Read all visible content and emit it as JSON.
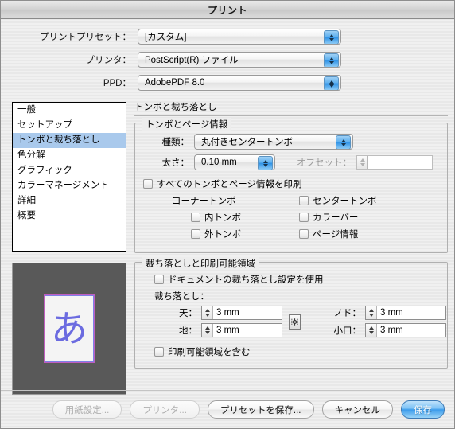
{
  "window": {
    "title": "プリント"
  },
  "top": {
    "rows": [
      {
        "label": "プリントプリセット：",
        "value": "[カスタム]"
      },
      {
        "label": "プリンタ：",
        "value": "PostScript(R) ファイル"
      },
      {
        "label": "PPD：",
        "value": "AdobePDF 8.0"
      }
    ]
  },
  "sidebar": {
    "items": [
      {
        "label": "一般"
      },
      {
        "label": "セットアップ"
      },
      {
        "label": "トンボと裁ち落とし"
      },
      {
        "label": "色分解"
      },
      {
        "label": "グラフィック"
      },
      {
        "label": "カラーマネージメント"
      },
      {
        "label": "詳細"
      },
      {
        "label": "概要"
      }
    ],
    "selected_index": 2
  },
  "preview": {
    "glyph": "あ"
  },
  "pane": {
    "heading": "トンボと裁ち落とし",
    "marks_group": {
      "title": "トンボとページ情報",
      "type_label": "種類：",
      "type_value": "丸付きセンタートンボ",
      "weight_label": "太さ：",
      "weight_value": "0.10 mm",
      "offset_label": "オフセット：",
      "offset_value": "",
      "print_all_label": "すべてのトンボとページ情報を印刷",
      "corner_label": "コーナートンボ",
      "inner_label": "内トンボ",
      "outer_label": "外トンボ",
      "center_label": "センタートンボ",
      "colorbar_label": "カラーバー",
      "pageinfo_label": "ページ情報"
    },
    "bleed_group": {
      "title": "裁ち落としと印刷可能領域",
      "use_doc_bleed_label": "ドキュメントの裁ち落とし設定を使用",
      "bleed_label": "裁ち落とし：",
      "top_label": "天：",
      "top_value": "3 mm",
      "bottom_label": "地：",
      "bottom_value": "3 mm",
      "inside_label": "ノド：",
      "inside_value": "3 mm",
      "outside_label": "小口：",
      "outside_value": "3 mm",
      "include_printable_label": "印刷可能領域を含む"
    }
  },
  "footer": {
    "buttons": [
      {
        "label": "用紙設定...",
        "state": "disabled"
      },
      {
        "label": "プリンタ...",
        "state": "disabled"
      },
      {
        "label": "プリセットを保存...",
        "state": "normal"
      },
      {
        "label": "キャンセル",
        "state": "normal"
      },
      {
        "label": "保存",
        "state": "default"
      }
    ]
  },
  "colors": {
    "selection": "#a9c9ec",
    "accent": "#3b9beb",
    "preview_bg": "#595959",
    "glyph": "#6b6be0"
  }
}
